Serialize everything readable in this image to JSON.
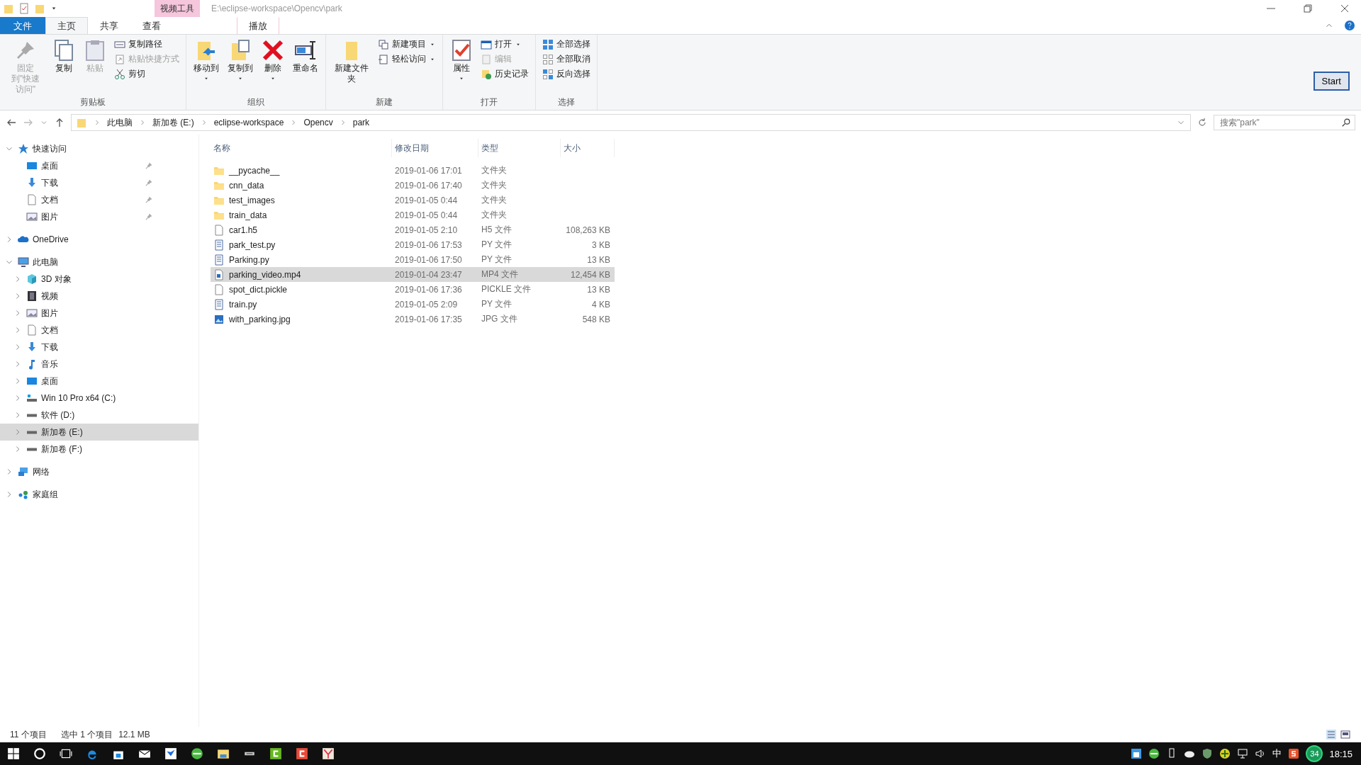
{
  "title_bar": {
    "context_tab": "视频工具",
    "path": "E:\\eclipse-workspace\\Opencv\\park"
  },
  "tabs": [
    {
      "label": "文件",
      "kind": "file",
      "selected": false
    },
    {
      "label": "主页",
      "kind": "tab",
      "selected": true
    },
    {
      "label": "共享",
      "kind": "tab",
      "selected": false
    },
    {
      "label": "查看",
      "kind": "tab",
      "selected": false
    },
    {
      "label": "播放",
      "kind": "context",
      "selected": false
    }
  ],
  "ribbon": {
    "groups": [
      {
        "label": "剪贴板",
        "items": [
          {
            "kind": "large",
            "label": "固定到\"快速访问\"",
            "disabled": true,
            "dropdown": false
          },
          {
            "kind": "large",
            "label": "复制",
            "disabled": false,
            "dropdown": false
          },
          {
            "kind": "large",
            "label": "粘贴",
            "disabled": true,
            "dropdown": false
          },
          {
            "kind": "stack",
            "items": [
              {
                "label": "复制路径",
                "disabled": false,
                "dropdown": false
              },
              {
                "label": "粘贴快捷方式",
                "disabled": true,
                "dropdown": false
              },
              {
                "label": "剪切",
                "disabled": false,
                "dropdown": false
              }
            ]
          }
        ]
      },
      {
        "label": "组织",
        "items": [
          {
            "kind": "large",
            "label": "移动到",
            "disabled": false,
            "dropdown": true
          },
          {
            "kind": "large",
            "label": "复制到",
            "disabled": false,
            "dropdown": true
          },
          {
            "kind": "large",
            "label": "删除",
            "disabled": false,
            "dropdown": true
          },
          {
            "kind": "large",
            "label": "重命名",
            "disabled": false,
            "dropdown": false
          }
        ]
      },
      {
        "label": "新建",
        "items": [
          {
            "kind": "large",
            "label": "新建文件夹",
            "disabled": false,
            "dropdown": false
          },
          {
            "kind": "stack",
            "items": [
              {
                "label": "新建项目",
                "disabled": false,
                "dropdown": true
              },
              {
                "label": "轻松访问",
                "disabled": false,
                "dropdown": true
              }
            ]
          }
        ]
      },
      {
        "label": "打开",
        "items": [
          {
            "kind": "large",
            "label": "属性",
            "disabled": false,
            "dropdown": true
          },
          {
            "kind": "stack",
            "items": [
              {
                "label": "打开",
                "disabled": false,
                "dropdown": true
              },
              {
                "label": "编辑",
                "disabled": true,
                "dropdown": false
              },
              {
                "label": "历史记录",
                "disabled": false,
                "dropdown": false
              }
            ]
          }
        ]
      },
      {
        "label": "选择",
        "items": [
          {
            "kind": "stack",
            "items": [
              {
                "label": "全部选择",
                "disabled": false,
                "dropdown": false
              },
              {
                "label": "全部取消",
                "disabled": false,
                "dropdown": false
              },
              {
                "label": "反向选择",
                "disabled": false,
                "dropdown": false
              }
            ]
          }
        ]
      }
    ]
  },
  "overlay_button": "Start",
  "address_bar": {
    "crumbs": [
      "此电脑",
      "新加卷 (E:)",
      "eclipse-workspace",
      "Opencv",
      "park"
    ]
  },
  "search": {
    "placeholder": "搜索\"park\""
  },
  "navigation": [
    {
      "label": "快速访问",
      "expanded": true,
      "selected": false,
      "children": [
        {
          "label": "桌面",
          "pinned": true,
          "selected": false
        },
        {
          "label": "下载",
          "pinned": true,
          "selected": false
        },
        {
          "label": "文档",
          "pinned": true,
          "selected": false
        },
        {
          "label": "图片",
          "pinned": true,
          "selected": false
        }
      ]
    },
    {
      "label": "OneDrive",
      "expanded": false,
      "selected": false
    },
    {
      "label": "此电脑",
      "expanded": true,
      "selected": false,
      "children": [
        {
          "label": "3D 对象",
          "expanded": false,
          "selected": false
        },
        {
          "label": "视频",
          "expanded": false,
          "selected": false
        },
        {
          "label": "图片",
          "expanded": false,
          "selected": false
        },
        {
          "label": "文档",
          "expanded": false,
          "selected": false
        },
        {
          "label": "下载",
          "expanded": false,
          "selected": false
        },
        {
          "label": "音乐",
          "expanded": false,
          "selected": false
        },
        {
          "label": "桌面",
          "expanded": false,
          "selected": false
        },
        {
          "label": "Win 10 Pro x64 (C:)",
          "expanded": false,
          "selected": false
        },
        {
          "label": "软件 (D:)",
          "expanded": false,
          "selected": false
        },
        {
          "label": "新加卷 (E:)",
          "expanded": false,
          "selected": true
        },
        {
          "label": "新加卷 (F:)",
          "expanded": false,
          "selected": false
        }
      ]
    },
    {
      "label": "网络",
      "expanded": false,
      "selected": false
    },
    {
      "label": "家庭组",
      "expanded": false,
      "selected": false
    }
  ],
  "file_list": {
    "columns": [
      "名称",
      "修改日期",
      "类型",
      "大小"
    ],
    "rows": [
      {
        "name": "__pycache__",
        "kind": "folder",
        "date": "2019-01-06 17:01",
        "type": "文件夹",
        "selected": false
      },
      {
        "name": "cnn_data",
        "kind": "folder",
        "date": "2019-01-06 17:40",
        "type": "文件夹",
        "selected": false
      },
      {
        "name": "test_images",
        "kind": "folder",
        "date": "2019-01-05 0:44",
        "type": "文件夹",
        "selected": false
      },
      {
        "name": "train_data",
        "kind": "folder",
        "date": "2019-01-05 0:44",
        "type": "文件夹",
        "selected": false
      },
      {
        "name": "car1.h5",
        "kind": "file",
        "date": "2019-01-05 2:10",
        "type": "H5 文件",
        "size": "108,263 KB",
        "selected": false
      },
      {
        "name": "park_test.py",
        "kind": "script",
        "date": "2019-01-06 17:53",
        "type": "PY 文件",
        "size": "3 KB",
        "selected": false
      },
      {
        "name": "Parking.py",
        "kind": "script",
        "date": "2019-01-06 17:50",
        "type": "PY 文件",
        "size": "13 KB",
        "selected": false
      },
      {
        "name": "parking_video.mp4",
        "kind": "video",
        "date": "2019-01-04 23:47",
        "type": "MP4 文件",
        "size": "12,454 KB",
        "selected": true
      },
      {
        "name": "spot_dict.pickle",
        "kind": "file",
        "date": "2019-01-06 17:36",
        "type": "PICKLE 文件",
        "size": "13 KB",
        "selected": false
      },
      {
        "name": "train.py",
        "kind": "script",
        "date": "2019-01-05 2:09",
        "type": "PY 文件",
        "size": "4 KB",
        "selected": false
      },
      {
        "name": "with_parking.jpg",
        "kind": "image",
        "date": "2019-01-06 17:35",
        "type": "JPG 文件",
        "size": "548 KB",
        "selected": false
      }
    ]
  },
  "status_bar": {
    "count": "11 个项目",
    "selection": "选中 1 个项目",
    "size": "12.1 MB"
  },
  "taskbar": {
    "ime": "中",
    "badge": "34",
    "time": "18:15"
  }
}
